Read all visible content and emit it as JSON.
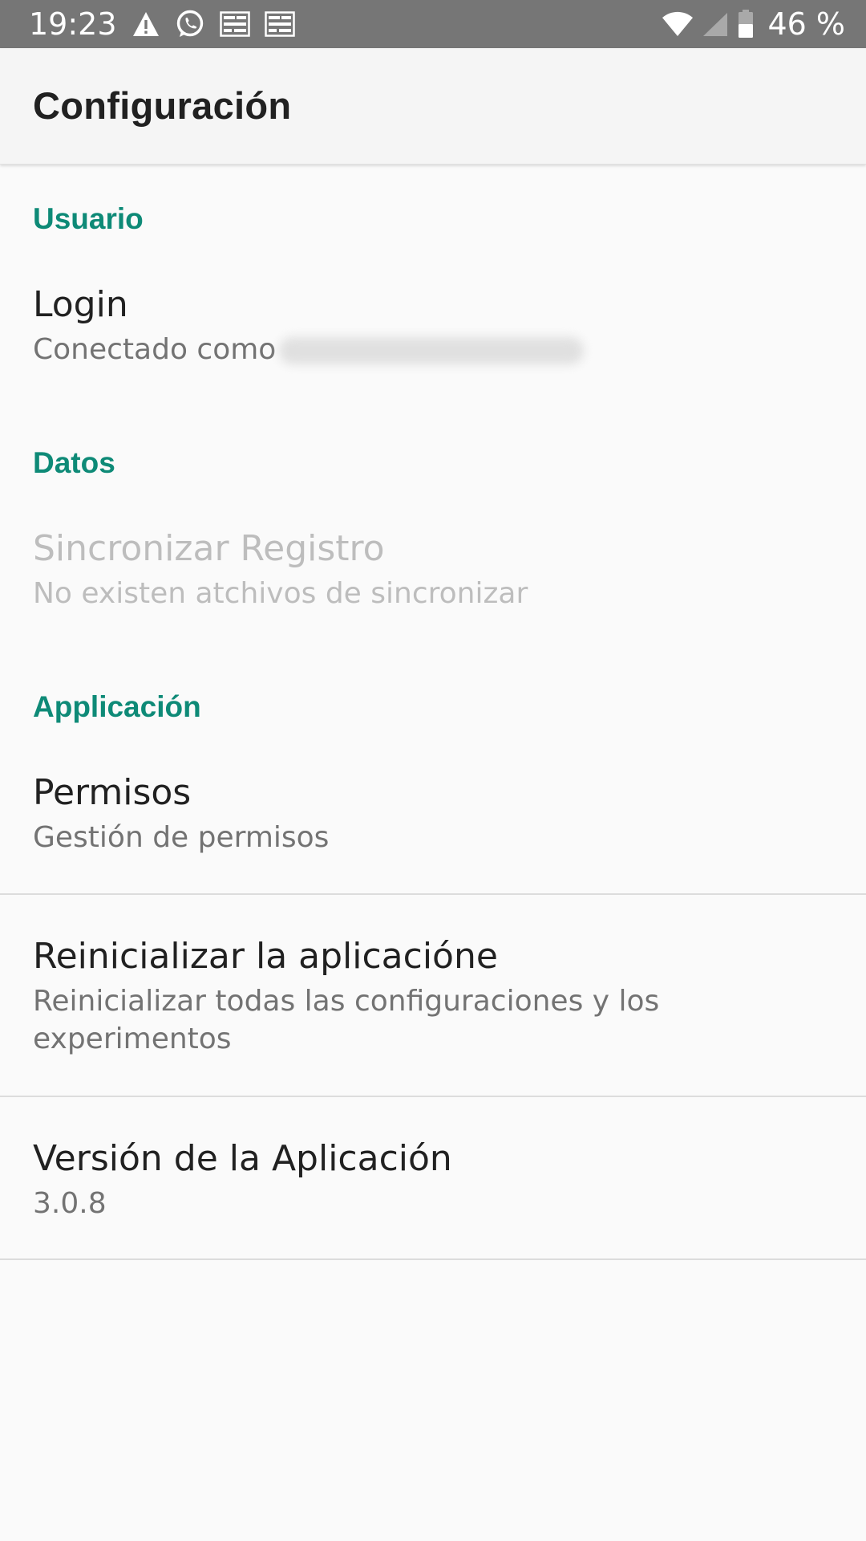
{
  "status_bar": {
    "time": "19:23",
    "battery": "46 %",
    "icons_left": [
      "warning-icon",
      "whatsapp-icon",
      "notification-icon",
      "notification-icon"
    ],
    "icons_right": [
      "wifi-icon",
      "signal-icon",
      "battery-icon"
    ]
  },
  "app_bar": {
    "title": "Configuración"
  },
  "sections": [
    {
      "header": "Usuario",
      "items": [
        {
          "title": "Login",
          "summary": "Conectado como"
        }
      ]
    },
    {
      "header": "Datos",
      "items": [
        {
          "title": "Sincronizar Registro",
          "summary": "No existen atchivos de sincronizar",
          "enabled": false
        }
      ]
    },
    {
      "header": "Applicación",
      "items": [
        {
          "title": "Permisos",
          "summary": "Gestión de permisos"
        },
        {
          "title": "Reinicializar la aplicacióne",
          "summary": "Reinicializar todas las configuraciones y los experimentos"
        },
        {
          "title": "Versión de la Aplicación",
          "summary": "3.0.8"
        }
      ]
    }
  ],
  "colors": {
    "accent": "#0e8a77",
    "status_bar": "#767676",
    "app_bar": "#f5f5f5",
    "background": "#fafafa"
  }
}
